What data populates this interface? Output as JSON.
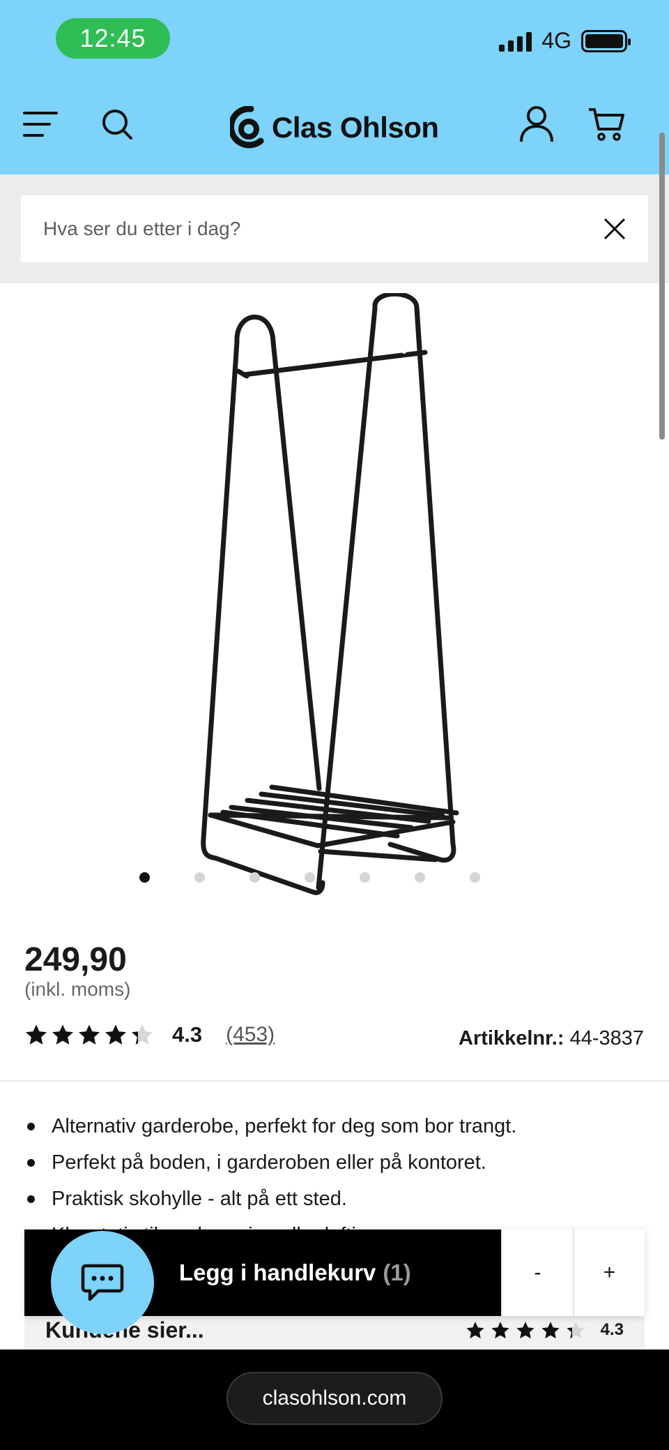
{
  "status_bar": {
    "time": "12:45",
    "network": "4G"
  },
  "header": {
    "brand": "Clas Ohlson",
    "icons": [
      "menu-icon",
      "search-icon",
      "account-icon",
      "cart-icon"
    ],
    "background_color": "#7dd3fa"
  },
  "search": {
    "placeholder": "Hva ser du etter i dag?"
  },
  "product": {
    "image_name": "clothes-rack-image",
    "carousel_total": 7,
    "carousel_active": 1,
    "price": "249,90",
    "vat_note": "(inkl. moms)",
    "rating": "4.3",
    "rating_stars": 4.3,
    "review_count": "(453)",
    "article_label": "Artikkelnr.:",
    "article_number": "44-3837",
    "features": [
      "Alternativ garderobe, perfekt for deg som bor trangt.",
      "Perfekt på boden, i garderoben eller på kontoret.",
      "Praktisk skohylle - alt på ett sted.",
      "Klesstativ til oppbevaring eller lufting."
    ]
  },
  "reviews": {
    "title": "Kundene sier...",
    "rating": "4.3"
  },
  "cart_bar": {
    "add_label": "Legg i handlekurv",
    "count": "(1)",
    "minus": "-",
    "plus": "+"
  },
  "chat": {
    "icon": "chat-icon",
    "color": "#7dd3fa"
  },
  "browser": {
    "url": "clasohlson.com"
  }
}
